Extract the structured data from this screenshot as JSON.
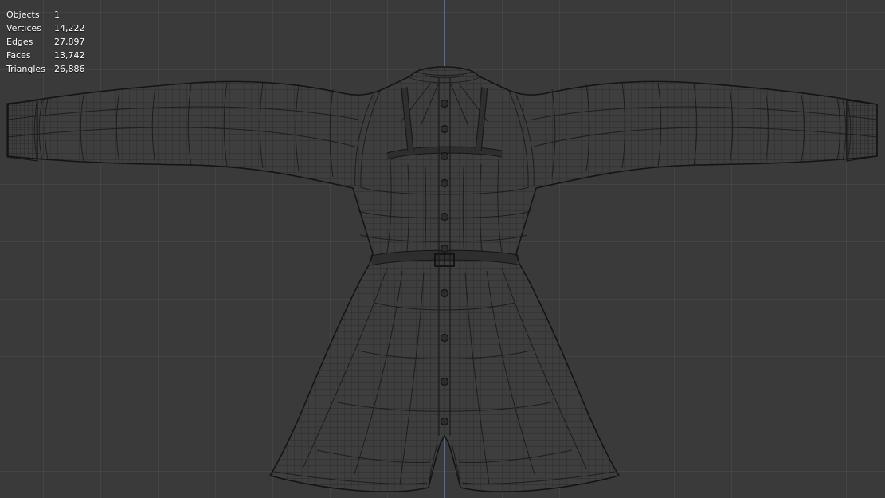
{
  "viewport": {
    "kind": "3d-wireframe-viewport",
    "stats": [
      {
        "label": "Objects",
        "value": "1"
      },
      {
        "label": "Vertices",
        "value": "14,222"
      },
      {
        "label": "Edges",
        "value": "27,897"
      },
      {
        "label": "Faces",
        "value": "13,742"
      },
      {
        "label": "Triangles",
        "value": "26,886"
      }
    ],
    "colors": {
      "background": "#3a3a3a",
      "grid_line": "#454545",
      "axis_z_blue": "#546eb4",
      "wire_line": "#1c1c1c",
      "mesh_fill": "#3e3e3e",
      "stats_text": "#ffffff"
    }
  }
}
